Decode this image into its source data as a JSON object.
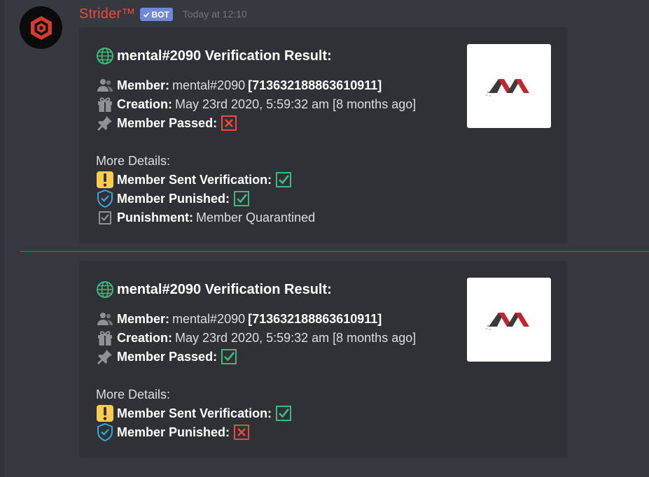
{
  "message": {
    "username": "Strider™",
    "bot_tag": "BOT",
    "timestamp": "Today at 12:10"
  },
  "embeds": [
    {
      "title": "mental#2090 Verification Result:",
      "member_label": "Member:",
      "member_value": "mental#2090",
      "member_id": "[713632188863610911]",
      "creation_label": "Creation:",
      "creation_value": "May 23rd 2020, 5:59:32 am [8 months ago]",
      "passed_label": "Member Passed:",
      "passed_status": "cross",
      "more_details": "More Details:",
      "sent_label": "Member Sent Verification:",
      "sent_status": "check",
      "punished_label": "Member Punished:",
      "punished_status": "check",
      "punishment_label": "Punishment:",
      "punishment_value": "Member Quarantined"
    },
    {
      "title": "mental#2090 Verification Result:",
      "member_label": "Member:",
      "member_value": "mental#2090",
      "member_id": "[713632188863610911]",
      "creation_label": "Creation:",
      "creation_value": "May 23rd 2020, 5:59:32 am [8 months ago]",
      "passed_label": "Member Passed:",
      "passed_status": "check",
      "more_details": "More Details:",
      "sent_label": "Member Sent Verification:",
      "sent_status": "check",
      "punished_label": "Member Punished:",
      "punished_status": "cross"
    }
  ],
  "colors": {
    "background": "#36393f",
    "embed": "#2f3136",
    "username": "#e74c3c",
    "bot_tag": "#7289da",
    "check": "#43b581",
    "cross": "#e74c3c",
    "warning": "#ffcc4d",
    "new_divider": "#b0453f"
  },
  "icons": [
    "globe-icon",
    "members-icon",
    "gift-icon",
    "pin-icon",
    "warning-icon",
    "shield-icon",
    "clipboard-icon",
    "check-icon",
    "cross-icon"
  ]
}
